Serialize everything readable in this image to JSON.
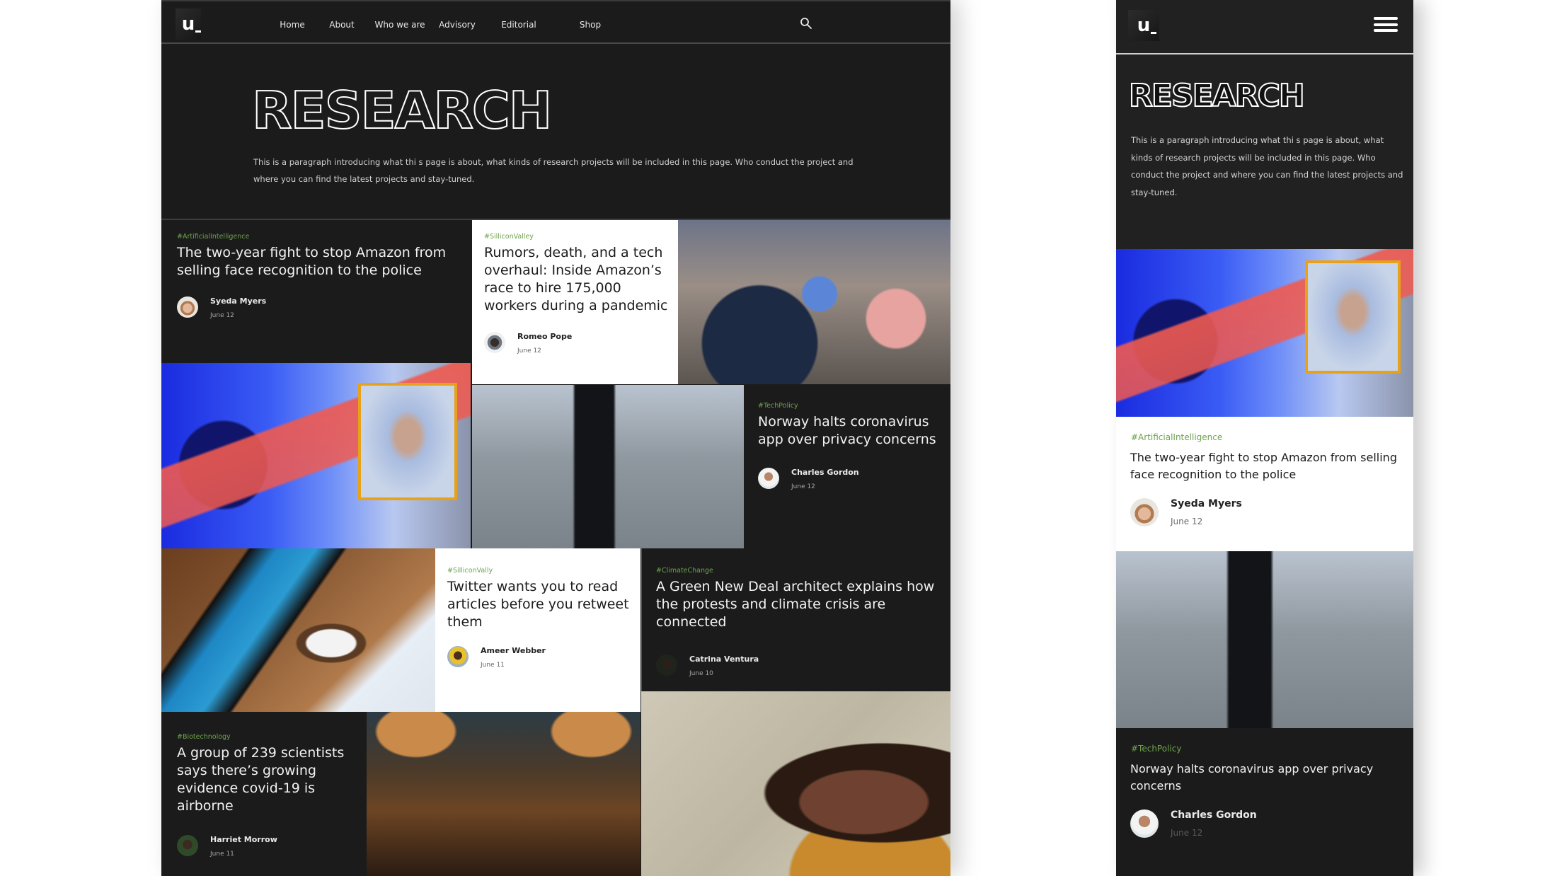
{
  "brand": {
    "logo_text": "u"
  },
  "nav": {
    "items": [
      {
        "label": "Home"
      },
      {
        "label": "About"
      },
      {
        "label": "Who we are"
      },
      {
        "label": "Advisory"
      },
      {
        "label": "Editorial"
      },
      {
        "label": "Shop"
      }
    ],
    "search_icon": "search-icon"
  },
  "hero": {
    "title": "RESEARCH",
    "intro": "This is a paragraph introducing what thi s page is about, what kinds of research projects will be included in this page. Who conduct the project and where you can find the latest projects and stay-tuned."
  },
  "colors": {
    "background": "#1b1b1b",
    "card_light": "#ffffff",
    "tag_green": "#6da34d",
    "accent_box": "#e8a21a"
  },
  "articles": [
    {
      "tag": "#ArtificialIntelligence",
      "title": "The two-year fight to stop Amazon from selling face recognition to the police",
      "author": "Syeda Myers",
      "date": "June 12"
    },
    {
      "tag": "#SilliconValley",
      "title": "Rumors, death, and a tech overhaul: Inside Amazon’s race to hire 175,000 workers during a pandemic",
      "author": "Romeo Pope",
      "date": "June 12"
    },
    {
      "tag": "#TechPolicy",
      "title": "Norway halts coronavirus app over privacy concerns",
      "author": "Charles Gordon",
      "date": "June 12"
    },
    {
      "tag": "#SilliconVally",
      "title": "Twitter wants you to read articles before you retweet them",
      "author": "Ameer Webber",
      "date": "June 11"
    },
    {
      "tag": "#ClimateChange",
      "title": "A Green New Deal architect explains how the protests and climate crisis are connected",
      "author": "Catrina Ventura",
      "date": "June 10"
    },
    {
      "tag": "#Biotechnology",
      "title": "A group of 239 scientists says there’s growing evidence covid-19 is airborne",
      "author": "Harriet Morrow",
      "date": "June 11"
    }
  ],
  "images": {
    "camera": "Surveillance camera with face recognition box",
    "crowd": "Crowd at a job fair shaking hands",
    "street": "Woman in beanie looking at phone on street",
    "phone": "Phone with Twitter app next to coffee cup",
    "restaurant": "Restaurant interior with lamps",
    "portrait": "Smiling woman portrait"
  },
  "mobile": {
    "menu_icon": "hamburger-icon"
  }
}
